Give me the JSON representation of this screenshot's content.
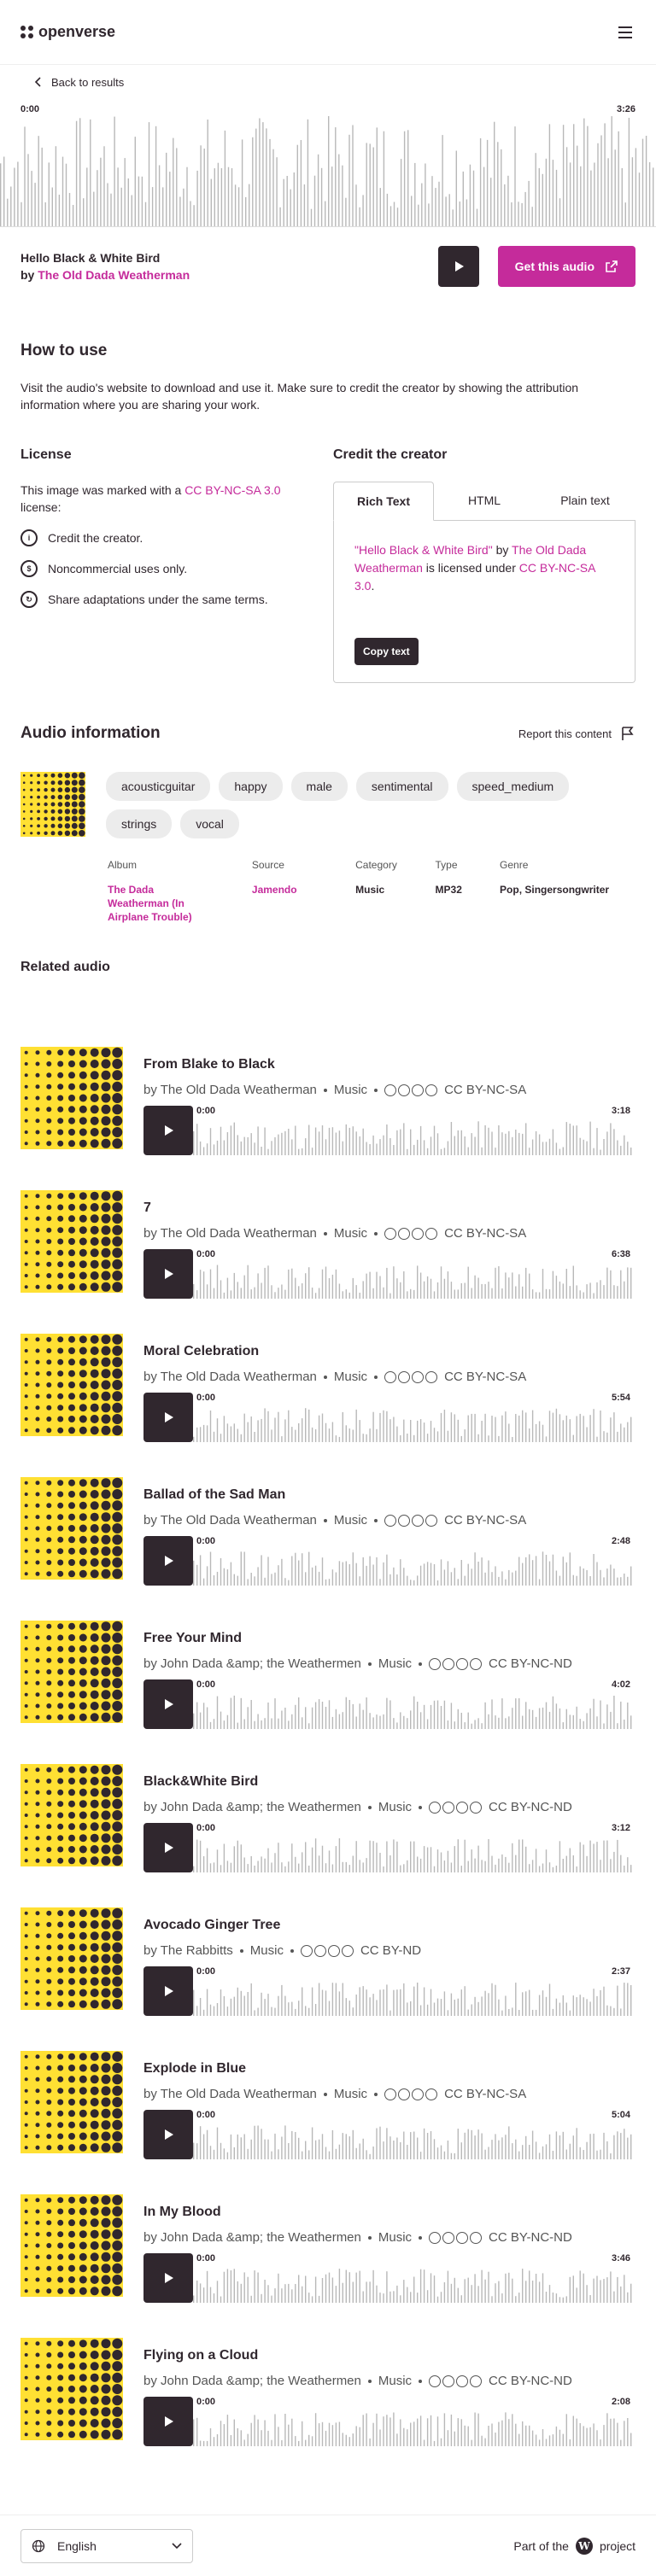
{
  "header": {
    "logo_text": "openverse",
    "menu_icon": "hamburger-icon"
  },
  "nav": {
    "back_label": "Back to results"
  },
  "player": {
    "current_time": "0:00",
    "duration": "3:26"
  },
  "audio": {
    "title": "Hello Black & White Bird",
    "by_prefix": "by",
    "creator": "The Old Dada Weatherman",
    "get_label": "Get this audio"
  },
  "how_to": {
    "heading": "How to use",
    "text": "Visit the audio's website to download and use it. Make sure to credit the creator by showing the attribution information where you are sharing your work."
  },
  "license": {
    "heading": "License",
    "intro_prefix": "This image was marked with a",
    "license_name": "CC BY-NC-SA 3.0",
    "intro_suffix": "license:",
    "items": [
      {
        "icon": "cc-by-icon",
        "text": "Credit the creator."
      },
      {
        "icon": "cc-nc-icon",
        "text": "Noncommercial uses only."
      },
      {
        "icon": "cc-sa-icon",
        "text": "Share adaptations under the same terms."
      }
    ]
  },
  "credit": {
    "heading": "Credit the creator",
    "tabs": [
      "Rich Text",
      "HTML",
      "Plain text"
    ],
    "quote_open": "\"",
    "title": "Hello Black & White Bird",
    "quote_close": "\"",
    "by": "by",
    "creator": "The Old Dada Weatherman",
    "licensed": "is licensed under",
    "license": "CC BY-NC-SA 3.0",
    "period": ".",
    "copy_label": "Copy text"
  },
  "info": {
    "heading": "Audio information",
    "report_label": "Report this content",
    "tags": [
      "acousticguitar",
      "happy",
      "male",
      "sentimental",
      "speed_medium",
      "strings",
      "vocal"
    ],
    "meta": [
      {
        "label": "Album",
        "value": "The Dada Weatherman (In Airplane Trouble)"
      },
      {
        "label": "Source",
        "value": "Jamendo"
      },
      {
        "label": "Category",
        "value": "Music"
      },
      {
        "label": "Type",
        "value": "MP32"
      },
      {
        "label": "Genre",
        "value": "Pop, Singersongwriter"
      }
    ]
  },
  "related": {
    "heading": "Related audio",
    "items": [
      {
        "title": "From Blake to Black",
        "creator": "by The Old Dada Weatherman",
        "category": "Music",
        "license": "CC BY-NC-SA",
        "start": "0:00",
        "duration": "3:18"
      },
      {
        "title": "7",
        "creator": "by The Old Dada Weatherman",
        "category": "Music",
        "license": "CC BY-NC-SA",
        "start": "0:00",
        "duration": "6:38"
      },
      {
        "title": "Moral Celebration",
        "creator": "by The Old Dada Weatherman",
        "category": "Music",
        "license": "CC BY-NC-SA",
        "start": "0:00",
        "duration": "5:54"
      },
      {
        "title": "Ballad of the Sad Man",
        "creator": "by The Old Dada Weatherman",
        "category": "Music",
        "license": "CC BY-NC-SA",
        "start": "0:00",
        "duration": "2:48"
      },
      {
        "title": "Free Your Mind",
        "creator": "by John Dada &amp; the Weathermen",
        "category": "Music",
        "license": "CC BY-NC-ND",
        "start": "0:00",
        "duration": "4:02"
      },
      {
        "title": "Black&White Bird",
        "creator": "by John Dada &amp; the Weathermen",
        "category": "Music",
        "license": "CC BY-NC-ND",
        "start": "0:00",
        "duration": "3:12"
      },
      {
        "title": "Avocado Ginger Tree",
        "creator": "by The Rabbitts",
        "category": "Music",
        "license": "CC BY-ND",
        "start": "0:00",
        "duration": "2:37"
      },
      {
        "title": "Explode in Blue",
        "creator": "by The Old Dada Weatherman",
        "category": "Music",
        "license": "CC BY-NC-SA",
        "start": "0:00",
        "duration": "5:04"
      },
      {
        "title": "In My Blood",
        "creator": "by John Dada &amp; the Weathermen",
        "category": "Music",
        "license": "CC BY-NC-ND",
        "start": "0:00",
        "duration": "3:46"
      },
      {
        "title": "Flying on a Cloud",
        "creator": "by John Dada &amp; the Weathermen",
        "category": "Music",
        "license": "CC BY-NC-ND",
        "start": "0:00",
        "duration": "2:08"
      }
    ]
  },
  "footer": {
    "language": "English",
    "part_of": "Part of the",
    "project": "project"
  },
  "colors": {
    "accent": "#c52b9b",
    "dark": "#30272e",
    "thumb": "#ffe033"
  }
}
